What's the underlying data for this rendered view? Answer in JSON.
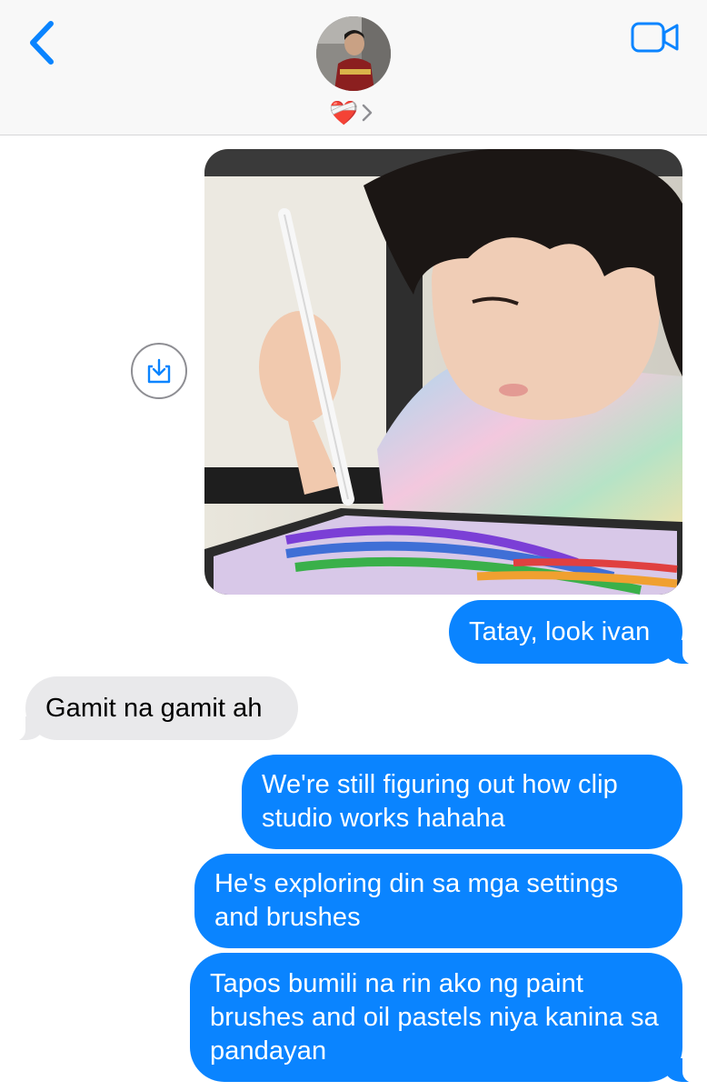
{
  "header": {
    "back_icon": "chevron-left-icon",
    "video_icon": "video-camera-icon",
    "contact_emoji": "❤️‍🩹",
    "contact_chevron_icon": "chevron-right-icon",
    "accent_color": "#0a84ff"
  },
  "thread": {
    "photo_message": {
      "description_icon": "photo-thumbnail",
      "save_icon": "save-download-icon"
    },
    "messages": [
      {
        "side": "sent",
        "text": "Tatay, look ivan"
      },
      {
        "side": "received",
        "text": "Gamit na gamit ah"
      },
      {
        "side": "sent",
        "text": "We're still figuring out how clip studio works hahaha"
      },
      {
        "side": "sent",
        "text": "He's exploring din sa mga settings and brushes"
      },
      {
        "side": "sent",
        "text": "Tapos bumili na rin ako ng paint brushes and oil pastels niya kanina sa pandayan"
      }
    ],
    "colors": {
      "sent_bubble": "#0a84ff",
      "received_bubble": "#e9e9eb"
    }
  }
}
